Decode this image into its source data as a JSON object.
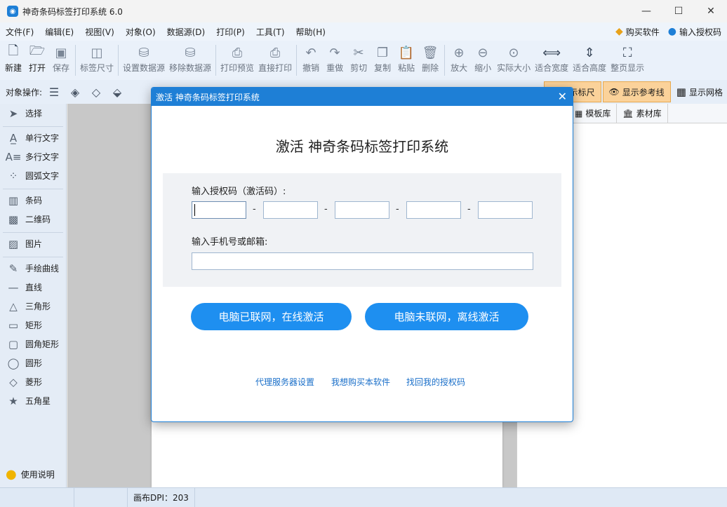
{
  "window": {
    "title": "神奇条码标签打印系统 6.0",
    "minimize": "—",
    "maximize": "☐",
    "close": "✕"
  },
  "menu": {
    "items": [
      "文件(F)",
      "编辑(E)",
      "视图(V)",
      "对象(O)",
      "数据源(D)",
      "打印(P)",
      "工具(T)",
      "帮助(H)"
    ],
    "buy": "购买软件",
    "license": "输入授权码"
  },
  "toolbar": {
    "items": [
      {
        "label": "新建",
        "icon": "new-file-icon"
      },
      {
        "label": "打开",
        "icon": "open-icon"
      },
      {
        "label": "保存",
        "icon": "save-icon"
      },
      {
        "label": "标签尺寸",
        "icon": "label-size-icon"
      },
      {
        "label": "设置数据源",
        "icon": "database-icon"
      },
      {
        "label": "移除数据源",
        "icon": "database-remove-icon"
      },
      {
        "label": "打印预览",
        "icon": "print-preview-icon"
      },
      {
        "label": "直接打印",
        "icon": "print-icon"
      },
      {
        "label": "撤销",
        "icon": "undo-icon"
      },
      {
        "label": "重做",
        "icon": "redo-icon"
      },
      {
        "label": "剪切",
        "icon": "cut-icon"
      },
      {
        "label": "复制",
        "icon": "copy-icon"
      },
      {
        "label": "粘贴",
        "icon": "paste-icon"
      },
      {
        "label": "删除",
        "icon": "delete-icon"
      },
      {
        "label": "放大",
        "icon": "zoom-in-icon"
      },
      {
        "label": "缩小",
        "icon": "zoom-out-icon"
      },
      {
        "label": "实际大小",
        "icon": "actual-size-icon"
      },
      {
        "label": "适合宽度",
        "icon": "fit-width-icon"
      },
      {
        "label": "适合高度",
        "icon": "fit-height-icon"
      },
      {
        "label": "整页显示",
        "icon": "fit-page-icon"
      }
    ]
  },
  "toolbar2": {
    "object_ops": "对象操作:",
    "show_ruler": "显示标尺",
    "show_guides": "显示参考线",
    "show_grid": "显示网格"
  },
  "left_panel": {
    "groups": [
      [
        {
          "label": "选择",
          "icon": "pointer-icon"
        }
      ],
      [
        {
          "label": "单行文字",
          "icon": "single-text-icon"
        },
        {
          "label": "多行文字",
          "icon": "multi-text-icon"
        },
        {
          "label": "圆弧文字",
          "icon": "arc-text-icon"
        }
      ],
      [
        {
          "label": "条码",
          "icon": "barcode-icon"
        },
        {
          "label": "二维码",
          "icon": "qrcode-icon"
        }
      ],
      [
        {
          "label": "图片",
          "icon": "image-icon"
        }
      ],
      [
        {
          "label": "手绘曲线",
          "icon": "pen-icon"
        },
        {
          "label": "直线",
          "icon": "line-icon"
        },
        {
          "label": "三角形",
          "icon": "triangle-icon"
        },
        {
          "label": "矩形",
          "icon": "rectangle-icon"
        },
        {
          "label": "圆角矩形",
          "icon": "rounded-rect-icon"
        },
        {
          "label": "圆形",
          "icon": "circle-icon"
        },
        {
          "label": "菱形",
          "icon": "diamond-icon"
        },
        {
          "label": "五角星",
          "icon": "star-icon"
        }
      ]
    ],
    "help": "使用说明"
  },
  "right_panel": {
    "tabs": [
      "模板库",
      "素材库"
    ]
  },
  "status_bar": {
    "dpi": "画布DPI：203"
  },
  "dialog": {
    "title": "激活 神奇条码标签打印系统",
    "heading": "激活 神奇条码标签打印系统",
    "code_label": "输入授权码（激活码）:",
    "code_separator": "-",
    "phone_label": "输入手机号或邮箱:",
    "online_button": "电脑已联网，在线激活",
    "offline_button": "电脑未联网，离线激活",
    "links": [
      "代理服务器设置",
      "我想购买本软件",
      "找回我的授权码"
    ]
  }
}
